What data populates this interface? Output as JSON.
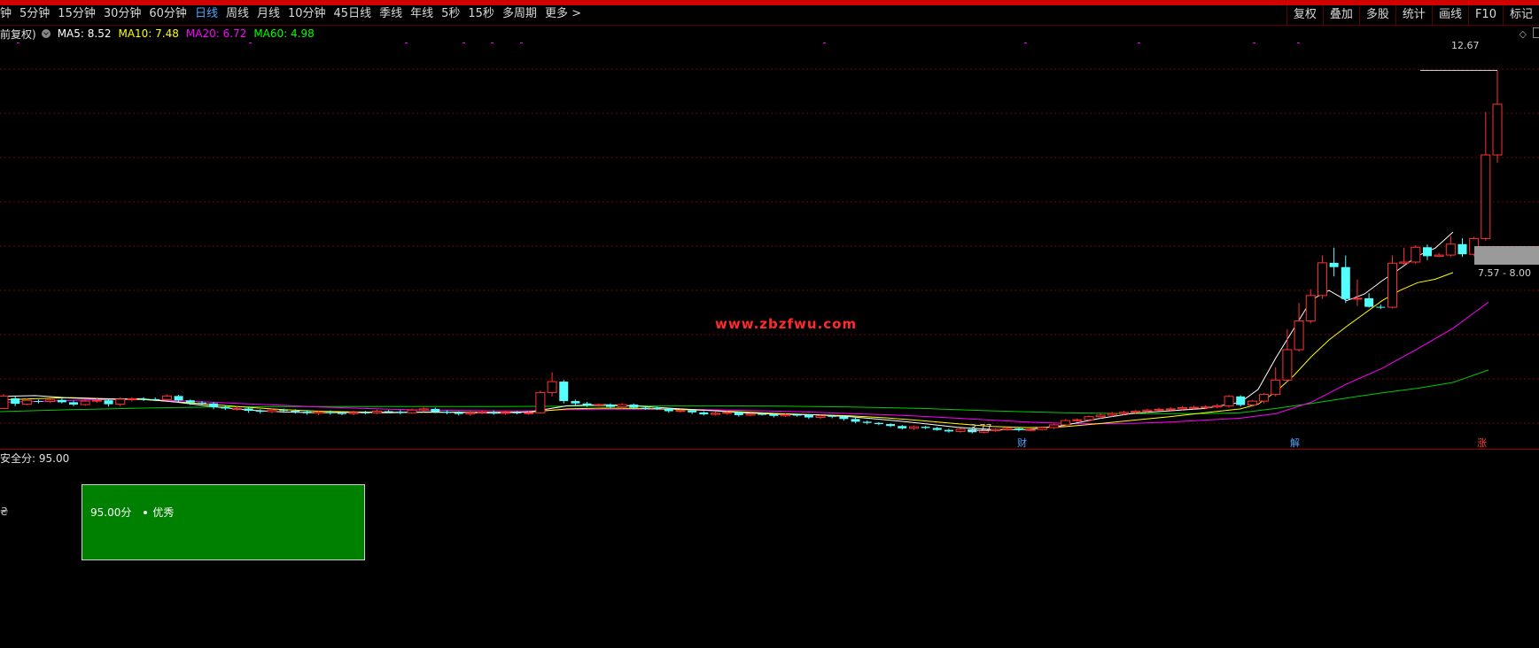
{
  "toolbar": {
    "periods": [
      {
        "label": "钟",
        "active": false
      },
      {
        "label": "5分钟",
        "active": false
      },
      {
        "label": "15分钟",
        "active": false
      },
      {
        "label": "30分钟",
        "active": false
      },
      {
        "label": "60分钟",
        "active": false
      },
      {
        "label": "日线",
        "active": true
      },
      {
        "label": "周线",
        "active": false
      },
      {
        "label": "月线",
        "active": false
      },
      {
        "label": "10分钟",
        "active": false
      },
      {
        "label": "45日线",
        "active": false
      },
      {
        "label": "季线",
        "active": false
      },
      {
        "label": "年线",
        "active": false
      },
      {
        "label": "5秒",
        "active": false
      },
      {
        "label": "15秒",
        "active": false
      },
      {
        "label": "多周期",
        "active": false
      },
      {
        "label": "更多 >",
        "active": false
      }
    ],
    "right_buttons": [
      "复权",
      "叠加",
      "多股",
      "统计",
      "画线",
      "F10",
      "标记"
    ]
  },
  "info": {
    "adjust": "前复权)",
    "ma5": {
      "label": "MA5: 8.52",
      "color": "#ffffff"
    },
    "ma10": {
      "label": "MA10: 7.48",
      "color": "#ffff00"
    },
    "ma20": {
      "label": "MA20: 6.72",
      "color": "#ff00ff"
    },
    "ma60": {
      "label": "MA60: 4.98",
      "color": "#00ff00"
    }
  },
  "chart_data": {
    "type": "candlestick",
    "ylim": [
      3.0,
      13.3
    ],
    "up_color": "#ff3232",
    "down_color": "#54ffff",
    "high_label": "12.67",
    "low_label": "3.77",
    "range_label": "7.57 - 8.00",
    "watermark": "www.zbzfwu.com",
    "candles": [
      [
        3.99,
        4.31,
        3.98,
        4.36
      ],
      [
        4.25,
        4.11,
        4.05,
        4.3
      ],
      [
        4.1,
        4.2,
        4.07,
        4.25
      ],
      [
        4.18,
        4.17,
        4.12,
        4.22
      ],
      [
        4.17,
        4.21,
        4.13,
        4.25
      ],
      [
        4.21,
        4.15,
        4.12,
        4.25
      ],
      [
        4.15,
        4.09,
        4.05,
        4.19
      ],
      [
        4.09,
        4.18,
        4.06,
        4.22
      ],
      [
        4.18,
        4.2,
        4.14,
        4.25
      ],
      [
        4.2,
        4.1,
        4.04,
        4.24
      ],
      [
        4.1,
        4.23,
        4.05,
        4.28
      ],
      [
        4.23,
        4.24,
        4.17,
        4.28
      ],
      [
        4.24,
        4.23,
        4.18,
        4.28
      ],
      [
        4.23,
        4.22,
        4.18,
        4.27
      ],
      [
        4.22,
        4.31,
        4.18,
        4.35
      ],
      [
        4.31,
        4.2,
        4.15,
        4.34
      ],
      [
        4.2,
        4.14,
        4.08,
        4.22
      ],
      [
        4.14,
        4.12,
        4.07,
        4.18
      ],
      [
        4.12,
        4.03,
        3.97,
        4.15
      ],
      [
        4.03,
        3.99,
        3.95,
        4.07
      ],
      [
        3.99,
        3.99,
        3.94,
        4.05
      ],
      [
        3.99,
        3.93,
        3.88,
        4.02
      ],
      [
        3.93,
        3.91,
        3.86,
        3.97
      ],
      [
        3.91,
        3.95,
        3.87,
        3.99
      ],
      [
        3.95,
        3.93,
        3.88,
        3.99
      ],
      [
        3.93,
        3.91,
        3.86,
        3.97
      ],
      [
        3.91,
        3.87,
        3.83,
        3.95
      ],
      [
        3.87,
        3.9,
        3.82,
        3.94
      ],
      [
        3.9,
        3.87,
        3.83,
        3.94
      ],
      [
        3.87,
        3.86,
        3.82,
        3.91
      ],
      [
        3.86,
        3.89,
        3.82,
        3.93
      ],
      [
        3.89,
        3.88,
        3.84,
        3.93
      ],
      [
        3.88,
        3.92,
        3.85,
        3.96
      ],
      [
        3.92,
        3.91,
        3.87,
        3.95
      ],
      [
        3.91,
        3.88,
        3.84,
        3.95
      ],
      [
        3.88,
        3.95,
        3.85,
        3.99
      ],
      [
        3.95,
        3.98,
        3.9,
        4.02
      ],
      [
        3.98,
        3.91,
        3.87,
        4.01
      ],
      [
        3.91,
        3.88,
        3.84,
        3.94
      ],
      [
        3.88,
        3.85,
        3.81,
        3.92
      ],
      [
        3.85,
        3.88,
        3.8,
        3.92
      ],
      [
        3.88,
        3.9,
        3.84,
        3.94
      ],
      [
        3.9,
        3.87,
        3.83,
        3.94
      ],
      [
        3.87,
        3.89,
        3.83,
        3.93
      ],
      [
        3.89,
        3.87,
        3.84,
        3.92
      ],
      [
        3.87,
        3.88,
        3.83,
        3.92
      ],
      [
        3.88,
        4.4,
        3.86,
        4.45
      ],
      [
        4.4,
        4.68,
        4.3,
        4.92
      ],
      [
        4.68,
        4.18,
        4.12,
        4.72
      ],
      [
        4.18,
        4.12,
        4.06,
        4.22
      ],
      [
        4.12,
        4.08,
        4.03,
        4.16
      ],
      [
        4.08,
        4.09,
        4.04,
        4.12
      ],
      [
        4.09,
        4.03,
        3.99,
        4.12
      ],
      [
        4.03,
        4.09,
        3.98,
        4.13
      ],
      [
        4.09,
        4.01,
        3.97,
        4.12
      ],
      [
        4.01,
        4.0,
        3.96,
        4.05
      ],
      [
        4.0,
        3.98,
        3.95,
        4.04
      ],
      [
        3.98,
        3.92,
        3.88,
        4.01
      ],
      [
        3.92,
        3.94,
        3.88,
        3.97
      ],
      [
        3.94,
        3.89,
        3.85,
        3.96
      ],
      [
        3.89,
        3.84,
        3.81,
        3.92
      ],
      [
        3.84,
        3.87,
        3.81,
        3.91
      ],
      [
        3.87,
        3.89,
        3.83,
        3.92
      ],
      [
        3.89,
        3.82,
        3.78,
        3.92
      ],
      [
        3.82,
        3.85,
        3.79,
        3.88
      ],
      [
        3.85,
        3.84,
        3.81,
        3.88
      ],
      [
        3.84,
        3.8,
        3.76,
        3.87
      ],
      [
        3.8,
        3.83,
        3.77,
        3.86
      ],
      [
        3.83,
        3.82,
        3.78,
        3.86
      ],
      [
        3.82,
        3.76,
        3.72,
        3.84
      ],
      [
        3.76,
        3.8,
        3.72,
        3.83
      ],
      [
        3.8,
        3.78,
        3.74,
        3.83
      ],
      [
        3.78,
        3.72,
        3.68,
        3.8
      ],
      [
        3.72,
        3.65,
        3.61,
        3.75
      ],
      [
        3.65,
        3.62,
        3.58,
        3.68
      ],
      [
        3.62,
        3.59,
        3.56,
        3.64
      ],
      [
        3.59,
        3.54,
        3.51,
        3.61
      ],
      [
        3.54,
        3.48,
        3.45,
        3.57
      ],
      [
        3.48,
        3.52,
        3.44,
        3.55
      ],
      [
        3.52,
        3.49,
        3.46,
        3.54
      ],
      [
        3.49,
        3.44,
        3.42,
        3.52
      ],
      [
        3.44,
        3.4,
        3.37,
        3.47
      ],
      [
        3.4,
        3.46,
        3.37,
        3.49
      ],
      [
        3.46,
        3.38,
        3.35,
        3.49
      ],
      [
        3.38,
        3.42,
        3.35,
        3.45
      ],
      [
        3.42,
        3.45,
        3.39,
        3.48
      ],
      [
        3.45,
        3.48,
        3.42,
        3.51
      ],
      [
        3.48,
        3.44,
        3.4,
        3.51
      ],
      [
        3.44,
        3.45,
        3.4,
        3.48
      ],
      [
        3.45,
        3.5,
        3.43,
        3.53
      ],
      [
        3.5,
        3.57,
        3.46,
        3.6
      ],
      [
        3.57,
        3.68,
        3.53,
        3.72
      ],
      [
        3.68,
        3.7,
        3.64,
        3.74
      ],
      [
        3.7,
        3.78,
        3.66,
        3.81
      ],
      [
        3.78,
        3.82,
        3.73,
        3.86
      ],
      [
        3.82,
        3.86,
        3.78,
        3.9
      ],
      [
        3.86,
        3.89,
        3.82,
        3.93
      ],
      [
        3.89,
        3.92,
        3.85,
        3.95
      ],
      [
        3.92,
        3.95,
        3.88,
        3.98
      ],
      [
        3.95,
        3.97,
        3.92,
        4.01
      ],
      [
        3.97,
        3.98,
        3.93,
        4.02
      ],
      [
        3.98,
        4.01,
        3.94,
        4.05
      ],
      [
        4.01,
        4.02,
        3.97,
        4.06
      ],
      [
        4.02,
        4.03,
        3.98,
        4.07
      ],
      [
        4.03,
        4.06,
        3.99,
        4.11
      ],
      [
        4.06,
        4.3,
        4.01,
        4.34
      ],
      [
        4.3,
        4.08,
        4.04,
        4.33
      ],
      [
        4.08,
        4.18,
        4.04,
        4.21
      ],
      [
        4.18,
        4.35,
        4.12,
        4.39
      ],
      [
        4.35,
        4.72,
        4.3,
        5.05
      ],
      [
        4.72,
        5.5,
        4.66,
        6.02
      ],
      [
        5.5,
        6.24,
        5.45,
        6.7
      ],
      [
        6.24,
        6.89,
        6.17,
        7.05
      ],
      [
        6.89,
        7.73,
        6.8,
        7.92
      ],
      [
        7.73,
        7.62,
        7.38,
        8.12
      ],
      [
        7.62,
        6.8,
        6.7,
        7.92
      ],
      [
        6.8,
        6.82,
        6.62,
        7.3
      ],
      [
        6.82,
        6.6,
        6.58,
        6.95
      ],
      [
        6.6,
        6.59,
        6.54,
        6.66
      ],
      [
        6.59,
        7.72,
        6.56,
        7.92
      ],
      [
        7.72,
        7.75,
        7.68,
        8.12
      ],
      [
        7.75,
        8.13,
        7.7,
        8.18
      ],
      [
        8.13,
        7.9,
        7.8,
        8.2
      ],
      [
        7.9,
        7.93,
        7.87,
        7.98
      ],
      [
        7.93,
        8.21,
        7.88,
        8.42
      ],
      [
        8.21,
        7.95,
        7.88,
        8.36
      ],
      [
        7.95,
        8.35,
        7.9,
        8.4
      ],
      [
        8.35,
        10.5,
        8.3,
        11.6
      ],
      [
        10.5,
        11.8,
        10.3,
        12.67
      ]
    ],
    "ma5": [
      [
        0,
        4.3
      ],
      [
        40,
        4.32
      ],
      [
        80,
        4.26
      ],
      [
        120,
        4.23
      ],
      [
        160,
        4.24
      ],
      [
        200,
        4.15
      ],
      [
        240,
        4.04
      ],
      [
        280,
        3.95
      ],
      [
        320,
        3.9
      ],
      [
        360,
        3.88
      ],
      [
        400,
        3.89
      ],
      [
        440,
        3.88
      ],
      [
        480,
        3.9
      ],
      [
        520,
        3.89
      ],
      [
        560,
        3.87
      ],
      [
        600,
        3.91
      ],
      [
        640,
        4.06
      ],
      [
        680,
        4.09
      ],
      [
        720,
        4.05
      ],
      [
        760,
        3.99
      ],
      [
        800,
        3.94
      ],
      [
        840,
        3.88
      ],
      [
        880,
        3.84
      ],
      [
        920,
        3.83
      ],
      [
        960,
        3.78
      ],
      [
        1000,
        3.7
      ],
      [
        1040,
        3.61
      ],
      [
        1080,
        3.51
      ],
      [
        1120,
        3.45
      ],
      [
        1160,
        3.45
      ],
      [
        1200,
        3.55
      ],
      [
        1240,
        3.73
      ],
      [
        1280,
        3.87
      ],
      [
        1320,
        3.93
      ],
      [
        1360,
        3.99
      ],
      [
        1400,
        4.15
      ],
      [
        1420,
        4.48
      ],
      [
        1440,
        5.29
      ],
      [
        1460,
        6.03
      ],
      [
        1480,
        6.78
      ],
      [
        1500,
        7.02
      ],
      [
        1520,
        6.76
      ],
      [
        1540,
        6.93
      ],
      [
        1560,
        7.27
      ],
      [
        1580,
        7.58
      ],
      [
        1600,
        7.91
      ],
      [
        1620,
        8.11
      ],
      [
        1640,
        8.52
      ]
    ],
    "ma10": [
      [
        0,
        4.21
      ],
      [
        40,
        4.24
      ],
      [
        80,
        4.27
      ],
      [
        120,
        4.24
      ],
      [
        160,
        4.22
      ],
      [
        200,
        4.16
      ],
      [
        240,
        4.09
      ],
      [
        280,
        4.02
      ],
      [
        320,
        3.96
      ],
      [
        360,
        3.92
      ],
      [
        400,
        3.9
      ],
      [
        440,
        3.89
      ],
      [
        480,
        3.89
      ],
      [
        520,
        3.89
      ],
      [
        560,
        3.89
      ],
      [
        600,
        3.9
      ],
      [
        640,
        3.98
      ],
      [
        680,
        4.0
      ],
      [
        720,
        3.99
      ],
      [
        760,
        3.97
      ],
      [
        800,
        3.94
      ],
      [
        840,
        3.9
      ],
      [
        880,
        3.86
      ],
      [
        920,
        3.83
      ],
      [
        960,
        3.8
      ],
      [
        1000,
        3.75
      ],
      [
        1040,
        3.68
      ],
      [
        1080,
        3.6
      ],
      [
        1120,
        3.53
      ],
      [
        1160,
        3.5
      ],
      [
        1200,
        3.52
      ],
      [
        1240,
        3.6
      ],
      [
        1280,
        3.69
      ],
      [
        1320,
        3.78
      ],
      [
        1360,
        3.88
      ],
      [
        1400,
        3.98
      ],
      [
        1420,
        4.1
      ],
      [
        1440,
        4.42
      ],
      [
        1460,
        4.83
      ],
      [
        1480,
        5.32
      ],
      [
        1500,
        5.75
      ],
      [
        1520,
        6.1
      ],
      [
        1540,
        6.43
      ],
      [
        1560,
        6.76
      ],
      [
        1580,
        7.02
      ],
      [
        1600,
        7.22
      ],
      [
        1620,
        7.31
      ],
      [
        1640,
        7.48
      ]
    ],
    "ma20": [
      [
        0,
        4.15
      ],
      [
        40,
        4.17
      ],
      [
        80,
        4.2
      ],
      [
        120,
        4.22
      ],
      [
        160,
        4.22
      ],
      [
        200,
        4.19
      ],
      [
        240,
        4.15
      ],
      [
        280,
        4.11
      ],
      [
        320,
        4.07
      ],
      [
        360,
        4.03
      ],
      [
        400,
        4.0
      ],
      [
        440,
        3.97
      ],
      [
        480,
        3.95
      ],
      [
        520,
        3.94
      ],
      [
        560,
        3.93
      ],
      [
        600,
        3.93
      ],
      [
        640,
        3.96
      ],
      [
        680,
        3.97
      ],
      [
        720,
        3.97
      ],
      [
        760,
        3.97
      ],
      [
        800,
        3.96
      ],
      [
        840,
        3.94
      ],
      [
        880,
        3.92
      ],
      [
        920,
        3.89
      ],
      [
        960,
        3.86
      ],
      [
        1000,
        3.83
      ],
      [
        1040,
        3.79
      ],
      [
        1080,
        3.74
      ],
      [
        1120,
        3.69
      ],
      [
        1160,
        3.64
      ],
      [
        1200,
        3.61
      ],
      [
        1240,
        3.6
      ],
      [
        1280,
        3.61
      ],
      [
        1320,
        3.64
      ],
      [
        1360,
        3.69
      ],
      [
        1400,
        3.74
      ],
      [
        1440,
        3.86
      ],
      [
        1480,
        4.15
      ],
      [
        1520,
        4.62
      ],
      [
        1560,
        5.02
      ],
      [
        1600,
        5.52
      ],
      [
        1640,
        6.05
      ],
      [
        1680,
        6.72
      ]
    ],
    "ma60": [
      [
        0,
        3.91
      ],
      [
        80,
        3.96
      ],
      [
        160,
        4.0
      ],
      [
        240,
        4.03
      ],
      [
        320,
        4.04
      ],
      [
        400,
        4.04
      ],
      [
        480,
        4.04
      ],
      [
        560,
        4.04
      ],
      [
        640,
        4.05
      ],
      [
        720,
        4.06
      ],
      [
        800,
        4.06
      ],
      [
        880,
        4.05
      ],
      [
        960,
        4.03
      ],
      [
        1040,
        3.99
      ],
      [
        1120,
        3.93
      ],
      [
        1200,
        3.88
      ],
      [
        1280,
        3.86
      ],
      [
        1360,
        3.86
      ],
      [
        1400,
        3.88
      ],
      [
        1440,
        3.99
      ],
      [
        1480,
        4.12
      ],
      [
        1520,
        4.26
      ],
      [
        1560,
        4.39
      ],
      [
        1600,
        4.51
      ],
      [
        1640,
        4.66
      ],
      [
        1680,
        4.98
      ]
    ],
    "events": [
      {
        "label": "财",
        "color": "#4fa3ff",
        "x": 1154
      },
      {
        "label": "解",
        "color": "#4fa3ff",
        "x": 1462
      },
      {
        "label": "涨",
        "color": "#ff4040",
        "x": 1673
      }
    ]
  },
  "indicator": {
    "title": "安全分: 95.00",
    "side_char": "₴",
    "score": "95.00分",
    "rating": "优秀"
  }
}
